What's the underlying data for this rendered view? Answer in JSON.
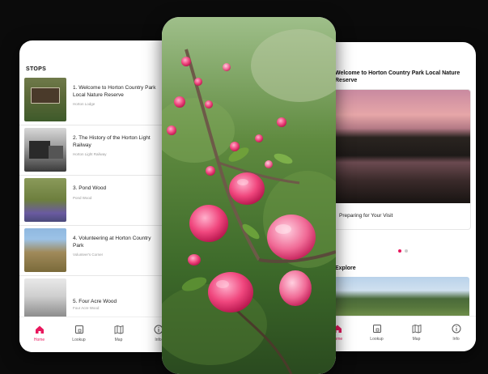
{
  "left_phone": {
    "section_title": "STOPS",
    "stops": [
      {
        "title": "1. Welcome to Horton Country Park Local Nature Reserve",
        "subtitle": "Horton Lodge"
      },
      {
        "title": "2. The History of the Horton Light Railway",
        "subtitle": "Horton Light Railway"
      },
      {
        "title": "3. Pond Wood",
        "subtitle": "Pond Wood"
      },
      {
        "title": "4. Volunteering at Horton Country Park",
        "subtitle": "Volunteer's Corner"
      },
      {
        "title": "5. Four Acre Wood",
        "subtitle": "Four Acre Wood"
      }
    ]
  },
  "tabbar": {
    "items": [
      {
        "label": "Home",
        "icon": "home-icon"
      },
      {
        "label": "Lookup",
        "icon": "lookup-icon"
      },
      {
        "label": "Map",
        "icon": "map-icon"
      },
      {
        "label": "Info",
        "icon": "info-icon"
      }
    ]
  },
  "right_phone": {
    "title": "Welcome to Horton Country Park Local Nature Reserve",
    "card_caption": "Preparing for Your Visit",
    "explore_title": "Explore"
  },
  "colors": {
    "accent": "#e8175d",
    "inactive_icon": "#555555",
    "dot_inactive": "#cccccc"
  }
}
